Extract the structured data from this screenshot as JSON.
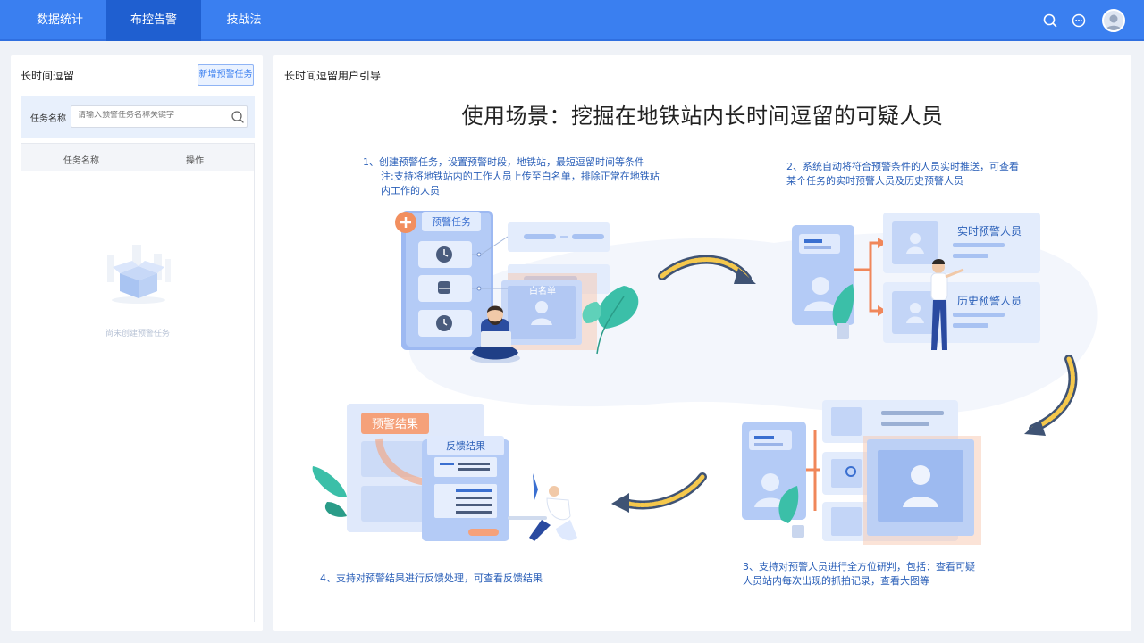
{
  "nav": {
    "items": [
      {
        "label": "数据统计"
      },
      {
        "label": "布控告警"
      },
      {
        "label": "技战法"
      }
    ]
  },
  "left": {
    "title": "长时间逗留",
    "new_button": "新增预警任务",
    "search_label": "任务名称",
    "search_placeholder": "请输入预警任务名称关键字",
    "table_headers": [
      "任务名称",
      "操作"
    ],
    "empty_text": "尚未创建预警任务"
  },
  "right": {
    "title": "长时间逗留用户引导",
    "heading": "使用场景：挖掘在地铁站内长时间逗留的可疑人员",
    "step1": "1、创建预警任务，设置预警时段，地铁站，最短逗留时间等条件",
    "step1_note": "注:支持将地铁站内的工作人员上传至白名单，排除正常在地铁站内工作的人员",
    "step2": "2、系统自动将符合预警条件的人员实时推送，可查看某个任务的实时预警人员及历史预警人员",
    "step3": "3、支持对预警人员进行全方位研判，包括：查看可疑人员站内每次出现的抓拍记录，查看大图等",
    "step4": "4、支持对预警结果进行反馈处理，可查看反馈结果",
    "ill_labels": {
      "task": "预警任务",
      "whitelist": "白名单",
      "realtime": "实时预警人员",
      "history": "历史预警人员",
      "result": "预警结果",
      "feedback": "反馈结果"
    }
  },
  "colors": {
    "brand": "#3a7ff0",
    "nav_active": "#1f5fd0",
    "step_text": "#2a5fb8"
  }
}
